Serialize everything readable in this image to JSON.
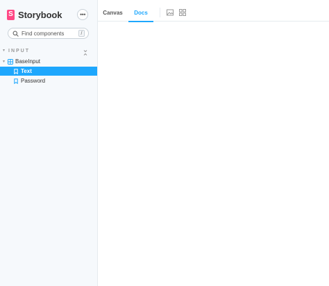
{
  "sidebar": {
    "brand": {
      "name": "Storybook",
      "logo_letter": "S",
      "logo_color": "#ff4785"
    },
    "menu_glyph": "•••",
    "search": {
      "placeholder": "Find components",
      "value": "",
      "shortcut": "/"
    },
    "group": {
      "title": "INPUT",
      "component": {
        "label": "BaseInput",
        "stories": [
          {
            "label": "Text",
            "selected": true
          },
          {
            "label": "Password",
            "selected": false
          }
        ]
      }
    }
  },
  "toolbar": {
    "tabs": [
      {
        "label": "Canvas",
        "active": false
      },
      {
        "label": "Docs",
        "active": true
      }
    ],
    "tools": [
      "image-icon",
      "grid-icon"
    ]
  },
  "colors": {
    "accent": "#1ea7fd",
    "brand": "#ff4785",
    "sidebar_bg": "#f6f9fc"
  }
}
